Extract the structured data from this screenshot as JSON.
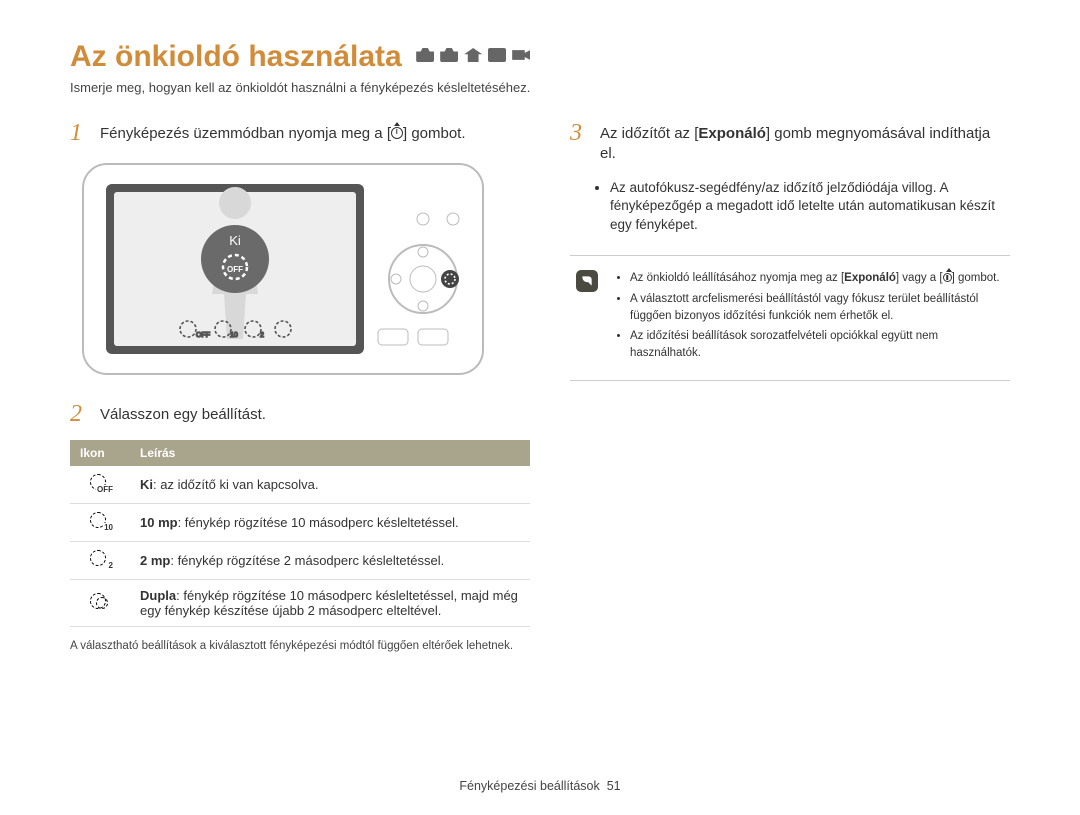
{
  "title": "Az önkioldó használata",
  "subtitle": "Ismerje meg, hogyan kell az önkioldót használni a fényképezés késleltetéséhez.",
  "step1": {
    "num": "1",
    "text_before": "Fényképezés üzemmódban nyomja meg a [",
    "text_after": "] gombot."
  },
  "camera_display": {
    "label": "Ki",
    "off": "OFF"
  },
  "step2": {
    "num": "2",
    "text": "Válasszon egy beállítást."
  },
  "table": {
    "header_icon": "Ikon",
    "header_desc": "Leírás",
    "rows": [
      {
        "sub": "OFF",
        "bold": "Ki",
        "desc": ": az időzítő ki van kapcsolva."
      },
      {
        "sub": "10",
        "bold": "10 mp",
        "desc": ": fénykép rögzítése 10 másodperc késleltetéssel."
      },
      {
        "sub": "2",
        "bold": "2 mp",
        "desc": ": fénykép rögzítése 2 másodperc késleltetéssel."
      },
      {
        "sub": "",
        "bold": "Dupla",
        "desc": ": fénykép rögzítése 10 másodperc késleltetéssel, majd még egy fénykép készítése újabb 2 másodperc elteltével."
      }
    ]
  },
  "table_footnote": "A választható beállítások a kiválasztott fényképezési módtól függően eltérőek lehetnek.",
  "step3": {
    "num": "3",
    "text_before": "Az időzítőt az [",
    "bold": "Exponáló",
    "text_after": "] gomb megnyomásával indíthatja el."
  },
  "bullets": [
    "Az autofókusz-segédfény/az időzítő jelződiódája villog. A fényképezőgép a megadott idő letelte után automatikusan készít egy fényképet."
  ],
  "note": {
    "items": [
      {
        "before": "Az önkioldó leállításához nyomja meg az [",
        "bold": "Exponáló",
        "after": "] vagy a [",
        "icon": true,
        "tail": "] gombot."
      },
      {
        "text": "A választott arcfelismerési beállítástól vagy fókusz terület beállítástól függően bizonyos időzítési funkciók nem érhetők el."
      },
      {
        "text": "Az időzítési beállítások sorozatfelvételi opciókkal együtt nem használhatók."
      }
    ]
  },
  "footer": {
    "label": "Fényképezési beállítások",
    "page": "51"
  }
}
